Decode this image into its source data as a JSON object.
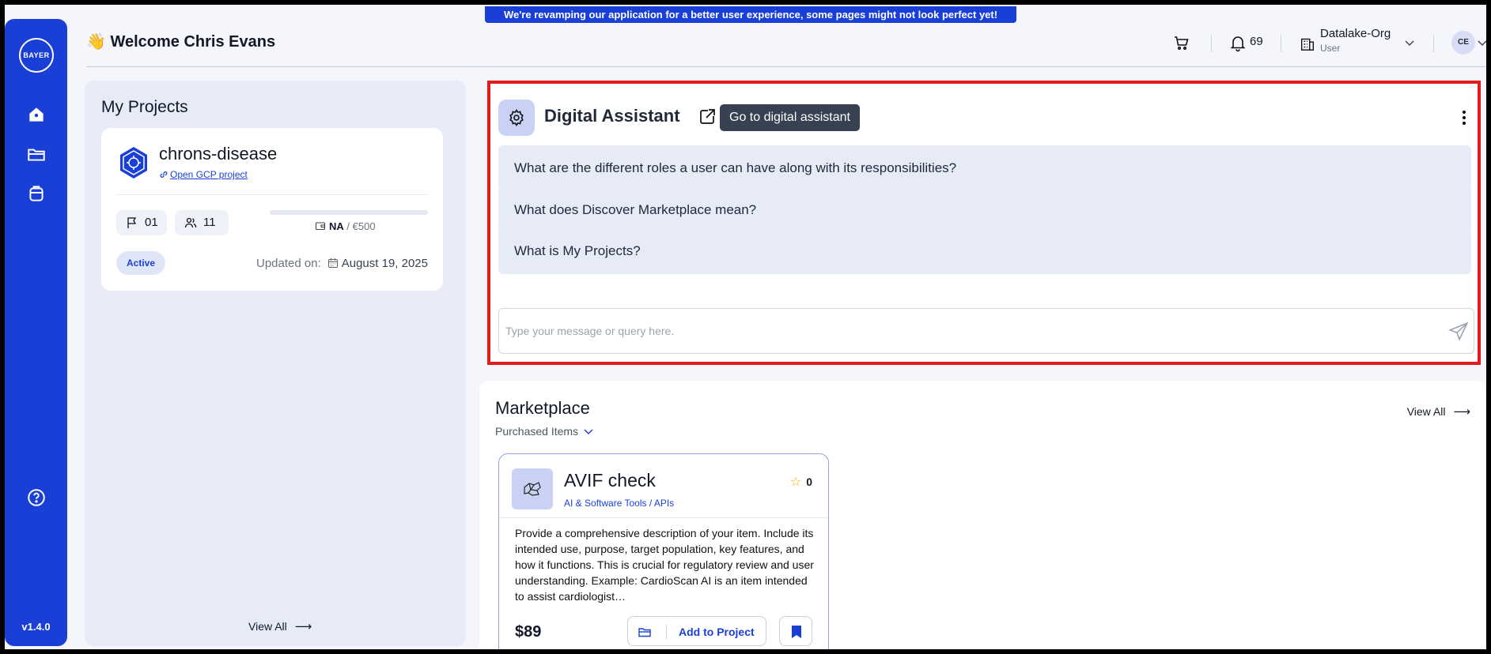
{
  "banner": {
    "text": "We're revamping our application for a better user experience, some pages might not look perfect yet!"
  },
  "sidebar": {
    "logo_text_h": "BAYER",
    "logo_text_v": "BAYER",
    "items": [
      {
        "icon": "home-icon"
      },
      {
        "icon": "folder-icon"
      },
      {
        "icon": "bag-icon"
      }
    ],
    "help_icon": "help-icon",
    "version": "v1.4.0"
  },
  "header": {
    "welcome": "👋 Welcome Chris Evans",
    "notifications_count": "69",
    "org_name": "Datalake-Org",
    "org_role": "User",
    "avatar_initials": "CE"
  },
  "projects": {
    "title": "My Projects",
    "card": {
      "name": "chrons-disease",
      "link_text": "Open GCP project",
      "flags": "01",
      "members": "11",
      "budget_used": "NA",
      "budget_total": "/ €500",
      "status": "Active",
      "updated_label": "Updated on:",
      "updated_date": "August 19, 2025"
    },
    "view_all": "View All"
  },
  "assistant": {
    "title": "Digital Assistant",
    "tooltip": "Go to digital assistant",
    "questions": [
      "What are the different roles a user can have along with its responsibilities?",
      "What does Discover Marketplace mean?",
      "What is My Projects?"
    ],
    "input_placeholder": "Type your message or query here.",
    "input_value": ""
  },
  "marketplace": {
    "title": "Marketplace",
    "filter": "Purchased Items",
    "view_all": "View All",
    "item": {
      "title": "AVIF check",
      "category": "AI & Software Tools / APIs",
      "rating": "0",
      "description": "Provide a comprehensive description of your item. Include its intended use, purpose, target population, key features, and how it functions. This is crucial for regulatory review and user understanding. Example: CardioScan AI is an item intended to assist cardiologist…",
      "price": "$89",
      "add_label": "Add to Project"
    }
  },
  "colors": {
    "brand_blue": "#1a3fd6",
    "highlight_red": "#e01b1b",
    "panel_bg": "#e6ebf7"
  }
}
